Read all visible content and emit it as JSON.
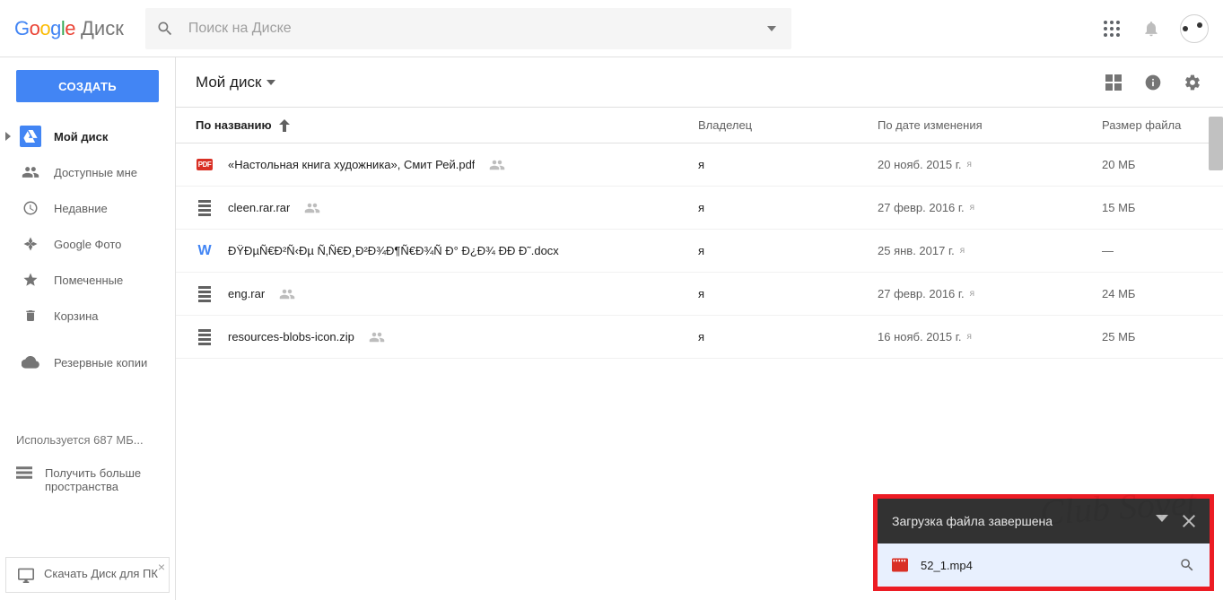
{
  "logo": {
    "product": "Диск"
  },
  "search": {
    "placeholder": "Поиск на Диске"
  },
  "create_button": "СОЗДАТЬ",
  "sidebar": {
    "items": [
      {
        "label": "Мой диск",
        "icon": "drive",
        "active": true,
        "expandable": true
      },
      {
        "label": "Доступные мне",
        "icon": "shared"
      },
      {
        "label": "Недавние",
        "icon": "recent"
      },
      {
        "label": "Google Фото",
        "icon": "photos"
      },
      {
        "label": "Помеченные",
        "icon": "star"
      },
      {
        "label": "Корзина",
        "icon": "trash"
      }
    ],
    "backups": "Резервные копии",
    "storage_text": "Используется 687 МБ...",
    "more_storage": "Получить больше пространства"
  },
  "download_card": {
    "text": "Скачать Диск для ПК"
  },
  "breadcrumb": "Мой диск",
  "columns": {
    "name": "По названию",
    "owner": "Владелец",
    "modified": "По дате изменения",
    "size": "Размер файла"
  },
  "files": [
    {
      "type": "pdf",
      "name": "«Настольная книга художника», Смит Рей.pdf",
      "shared": true,
      "owner": "я",
      "modified": "20 нояб. 2015 г.",
      "who": "я",
      "size": "20 МБ"
    },
    {
      "type": "archive",
      "name": "cleen.rar.rar",
      "shared": true,
      "owner": "я",
      "modified": "27 февр. 2016 г.",
      "who": "я",
      "size": "15 МБ"
    },
    {
      "type": "word",
      "name": "ÐŸÐµÑ€Ð²Ñ‹Ðµ Ñ‚Ñ€Ð¸Ð²Ð¾Ð¶Ñ€Ð¾Ñ Ð° Ð¿Ð¾ ÐÐ Ð˜.docx",
      "shared": false,
      "owner": "я",
      "modified": "25 янв. 2017 г.",
      "who": "я",
      "size": "—"
    },
    {
      "type": "archive",
      "name": "eng.rar",
      "shared": true,
      "owner": "я",
      "modified": "27 февр. 2016 г.",
      "who": "я",
      "size": "24 МБ"
    },
    {
      "type": "archive",
      "name": "resources-blobs-icon.zip",
      "shared": true,
      "owner": "я",
      "modified": "16 нояб. 2015 г.",
      "who": "я",
      "size": "25 МБ"
    }
  ],
  "upload": {
    "title": "Загрузка файла завершена",
    "file": "52_1.mp4"
  },
  "watermark": "Club Sovet"
}
